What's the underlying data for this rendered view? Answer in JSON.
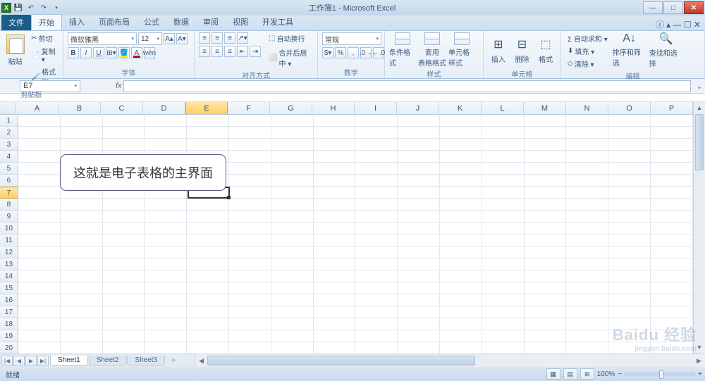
{
  "title": "工作簿1 - Microsoft Excel",
  "tabs": {
    "file": "文件",
    "items": [
      "开始",
      "插入",
      "页面布局",
      "公式",
      "数据",
      "审阅",
      "视图",
      "开发工具"
    ],
    "active_index": 0
  },
  "ribbon": {
    "clipboard": {
      "label": "剪贴板",
      "paste": "粘贴",
      "cut": "剪切",
      "copy": "复制 ▾",
      "fmt": "格式刷"
    },
    "font": {
      "label": "字体",
      "name": "微软雅黑",
      "size": "12",
      "bold": "B",
      "italic": "I",
      "underline": "U"
    },
    "align": {
      "label": "对齐方式",
      "wrap": "自动换行",
      "merge": "合并后居中 ▾"
    },
    "number": {
      "label": "数字",
      "format": "常规"
    },
    "styles": {
      "label": "样式",
      "cond": "条件格式",
      "table": "套用\n表格格式",
      "cell": "单元格样式"
    },
    "cells": {
      "label": "单元格",
      "insert": "插入",
      "delete": "删除",
      "format": "格式"
    },
    "editing": {
      "label": "编辑",
      "sum": "Σ 自动求和 ▾",
      "fill": "填充 ▾",
      "clear": "清除 ▾",
      "sort": "排序和筛选",
      "find": "查找和选择"
    }
  },
  "formula": {
    "cell_ref": "E7",
    "fx": "fx"
  },
  "columns": [
    "A",
    "B",
    "C",
    "D",
    "E",
    "F",
    "G",
    "H",
    "I",
    "J",
    "K",
    "L",
    "M",
    "N",
    "O",
    "P"
  ],
  "rows": [
    1,
    2,
    3,
    4,
    5,
    6,
    7,
    8,
    9,
    10,
    11,
    12,
    13,
    14,
    15,
    16,
    17,
    18,
    19,
    20
  ],
  "selected": {
    "col": "E",
    "row": 7
  },
  "callout_text": "这就是电子表格的主界面",
  "sheets": {
    "items": [
      "Sheet1",
      "Sheet2",
      "Sheet3"
    ],
    "active": 0
  },
  "status": {
    "ready": "就绪",
    "zoom": "100%"
  },
  "watermark": {
    "brand": "Baidu 经验",
    "sub": "jingyan.baidu.com"
  }
}
